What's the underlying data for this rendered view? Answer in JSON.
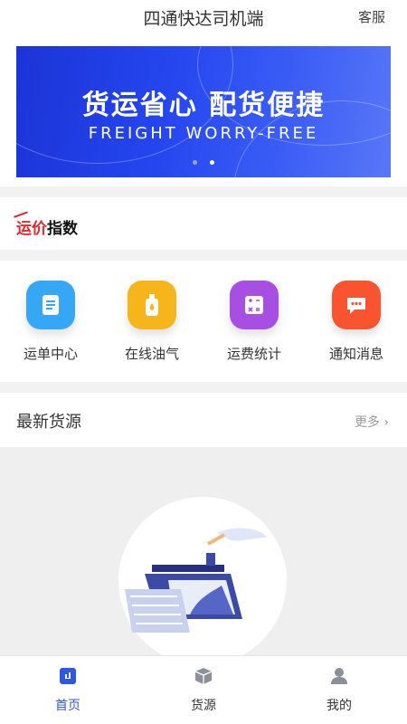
{
  "header": {
    "title": "四通快达司机端",
    "service_label": "客服"
  },
  "banner": {
    "headline": "货运省心 配货便捷",
    "subline": "FREIGHT WORRY-FREE",
    "pagination": {
      "total": 2,
      "active": 1
    }
  },
  "freight_index": {
    "label_red": "运价",
    "label_black": "指数"
  },
  "quick_actions": [
    {
      "label": "运单中心",
      "icon": "document-icon",
      "color": "#35a7f5"
    },
    {
      "label": "在线油气",
      "icon": "oil-bottle-icon",
      "color": "#f6b51b"
    },
    {
      "label": "运费统计",
      "icon": "calculator-icon",
      "color": "#a84fe3"
    },
    {
      "label": "通知消息",
      "icon": "message-icon",
      "color": "#f8542f"
    }
  ],
  "latest_supply": {
    "title": "最新货源",
    "more_label": "更多"
  },
  "tabbar": [
    {
      "label": "首页",
      "icon": "home-icon",
      "active": true
    },
    {
      "label": "货源",
      "icon": "cargo-box-icon",
      "active": false
    },
    {
      "label": "我的",
      "icon": "user-icon",
      "active": false
    }
  ],
  "colors": {
    "accent": "#2f57e0",
    "red": "#e4262c"
  }
}
